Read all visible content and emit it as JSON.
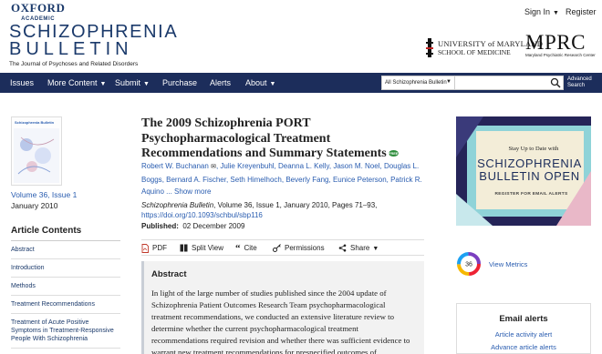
{
  "topbar": {
    "publisher": "OXFORD",
    "publisher_sub": "ACADEMIC",
    "sign_in": "Sign In",
    "register": "Register"
  },
  "brand": {
    "line1": "SCHIZOPHRENIA",
    "line2": "BULLETIN",
    "tagline": "The Journal of Psychoses and Related Disorders",
    "umd_line1": "UNIVERSITY of MARYLAND",
    "umd_line2": "SCHOOL OF MEDICINE",
    "mprc": "MPRC",
    "mprc_sub": "Maryland Psychiatric Research Center"
  },
  "nav": {
    "items": [
      "Issues",
      "More Content",
      "Submit",
      "Purchase",
      "Alerts",
      "About"
    ],
    "search_scope": "All Schizophrenia Bulletin",
    "search_value": "",
    "advanced_line1": "Advanced",
    "advanced_line2": "Search"
  },
  "sidebar": {
    "cover_title": "Schizophrenia Bulletin",
    "volume": "Volume 36, Issue 1",
    "date": "January 2010",
    "contents_heading": "Article Contents",
    "toc": [
      "Abstract",
      "Introduction",
      "Methods",
      "Treatment Recommendations",
      "Treatment of Acute Positive Symptoms in Treatment-Responsive People With Schizophrenia"
    ]
  },
  "article": {
    "title": "The 2009 Schizophrenia PORT Psychopharmacological Treatment Recommendations and Summary Statements",
    "free_badge": "FREE",
    "authors": [
      "Robert W. Buchanan",
      "Julie Kreyenbuhl",
      "Deanna L. Kelly",
      "Jason M. Noel",
      "Douglas L. Boggs",
      "Bernard A. Fischer",
      "Seth Himelhoch",
      "Beverly Fang",
      "Eunice Peterson",
      "Patrick R. Aquino"
    ],
    "show_more": "Show more",
    "journal": "Schizophrenia Bulletin",
    "citation_rest": ", Volume 36, Issue 1, January 2010, Pages 71–93,",
    "doi": "https://doi.org/10.1093/schbul/sbp116",
    "published_label": "Published:",
    "published_date": "02 December 2009",
    "tools": [
      "PDF",
      "Split View",
      "Cite",
      "Permissions",
      "Share"
    ],
    "abstract_heading": "Abstract",
    "abstract_text": "In light of the large number of studies published since the 2004 update of Schizophrenia Patient Outcomes Research Team psychopharmacological treatment recommendations, we conducted an extensive literature review to determine whether the current psychopharmacological treatment recommendations required revision and whether there was sufficient evidence to warrant new treatment recommendations for prespecified outcomes of"
  },
  "right": {
    "promo_line1": "Stay Up to Date with",
    "promo_line2": "SCHIZOPHRENIA BULLETIN OPEN",
    "promo_line3": "REGISTER FOR EMAIL ALERTS",
    "metric_score": "36",
    "metrics_link": "View Metrics",
    "alerts_heading": "Email alerts",
    "alert1": "Article activity alert",
    "alert2": "Advance article alerts"
  },
  "colors": {
    "nav_bg": "#1c2d5b",
    "link": "#2a5db0",
    "brand_blue": "#1b3a6b",
    "promo_teal": "#8fd3d8",
    "promo_cream": "#f3edd8"
  }
}
